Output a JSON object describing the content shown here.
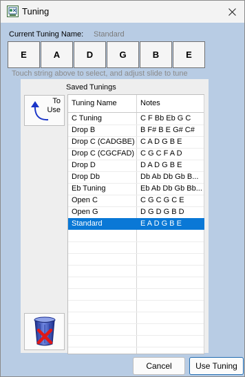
{
  "window": {
    "title": "Tuning"
  },
  "current": {
    "label": "Current Tuning Name:",
    "value": "Standard"
  },
  "strings": [
    "E",
    "A",
    "D",
    "G",
    "B",
    "E"
  ],
  "hint": "Touch string above to select, and adjust slide to tune",
  "saved": {
    "label": "Saved Tunings",
    "to_use_label": "To\nUse",
    "columns": [
      "Tuning Name",
      "Notes"
    ],
    "rows": [
      {
        "name": "C Tuning",
        "notes": "C F Bb Eb G C"
      },
      {
        "name": "Drop B",
        "notes": "B F# B E G# C#"
      },
      {
        "name": "Drop C (CADGBE)",
        "notes": "C A D G B E"
      },
      {
        "name": "Drop C (CGCFAD)",
        "notes": "C G C F A D"
      },
      {
        "name": "Drop D",
        "notes": "D A D G B E"
      },
      {
        "name": "Drop Db",
        "notes": "Db Ab Db Gb B..."
      },
      {
        "name": "Eb Tuning",
        "notes": "Eb Ab Db Gb Bb..."
      },
      {
        "name": "Open C",
        "notes": "C G C G C E"
      },
      {
        "name": "Open G",
        "notes": "D G D G B D"
      },
      {
        "name": "Standard",
        "notes": "E A D G B E"
      }
    ],
    "selected_index": 9
  },
  "buttons": {
    "cancel": "Cancel",
    "use": "Use Tuning"
  },
  "colors": {
    "background": "#b8cce4",
    "selection": "#0a78d6",
    "title_bar": "#f3f3f3"
  },
  "icons": [
    "tuning-app-icon",
    "close-icon",
    "curved-arrow-icon",
    "trash-can-icon",
    "red-x-icon"
  ]
}
